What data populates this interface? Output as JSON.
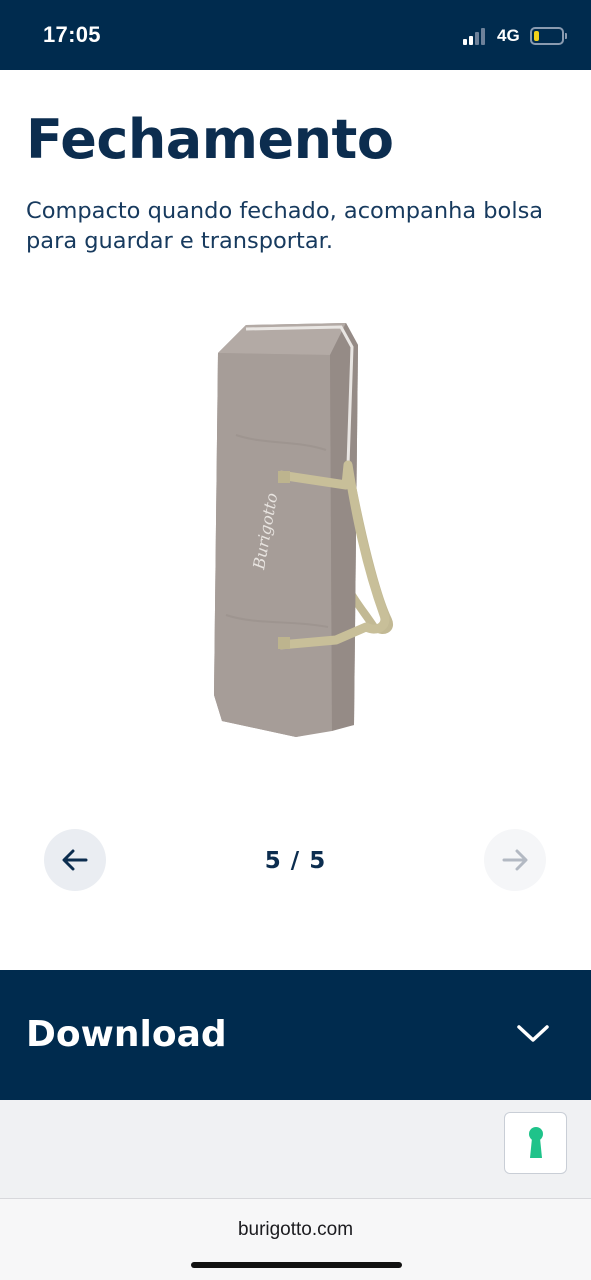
{
  "status_bar": {
    "time": "17:05",
    "network": "4G",
    "background_color": "#002b4e",
    "battery_color": "#f2d21b"
  },
  "main": {
    "title": "Fechamento",
    "description": "Compacto quando fechado, acompanha bolsa para guardar e transportar.",
    "product_image": {
      "icon": "folded-playard-bag-image",
      "brand_mark": "Burigotto"
    }
  },
  "carousel": {
    "counter": "5 / 5",
    "prev_icon": "arrow-left-icon",
    "next_icon": "arrow-right-icon"
  },
  "download": {
    "label": "Download",
    "icon": "chevron-down-icon",
    "background_color": "#002b4e"
  },
  "accessibility_button": {
    "icon": "keyhole-icon",
    "color": "#1fc38a"
  },
  "browser": {
    "url": "burigotto.com"
  },
  "colors": {
    "primary": "#0c2d4f",
    "text": "#173a5e"
  }
}
